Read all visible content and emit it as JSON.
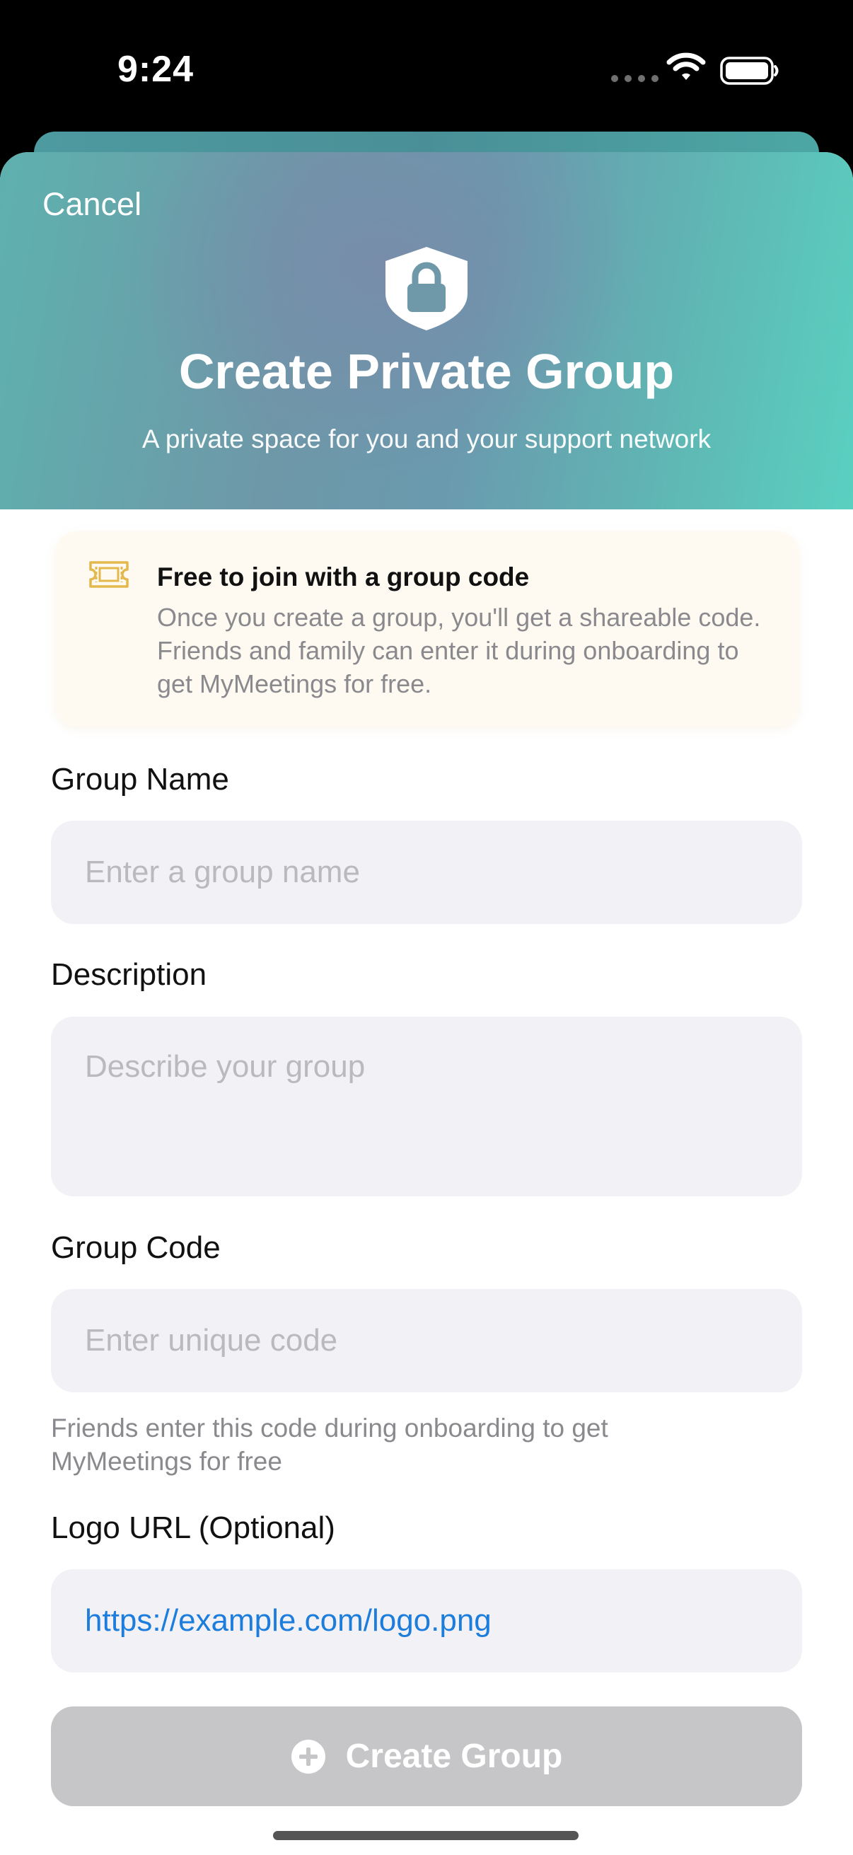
{
  "status_bar": {
    "time": "9:24"
  },
  "header": {
    "cancel_label": "Cancel",
    "title": "Create Private Group",
    "subtitle": "A private space for you and your support network",
    "icon": "lock-shield-icon"
  },
  "info_card": {
    "icon": "ticket-icon",
    "title": "Free to join with a group code",
    "body": "Once you create a group, you'll get a shareable code. Friends and family can enter it during onboarding to get MyMeetings for free."
  },
  "form": {
    "group_name": {
      "label": "Group Name",
      "placeholder": "Enter a group name"
    },
    "description": {
      "label": "Description",
      "placeholder": "Describe your group"
    },
    "group_code": {
      "label": "Group Code",
      "placeholder": "Enter unique code",
      "help": "Friends enter this code during onboarding to get MyMeetings for free"
    },
    "logo_url": {
      "label": "Logo URL (Optional)",
      "value": "https://example.com/logo.png"
    }
  },
  "create_button": {
    "label": "Create Group",
    "icon": "plus-circle-icon"
  },
  "colors": {
    "accent": "#5ab5b0",
    "link": "#1d7ddc",
    "button_disabled": "#c6c6c8"
  }
}
